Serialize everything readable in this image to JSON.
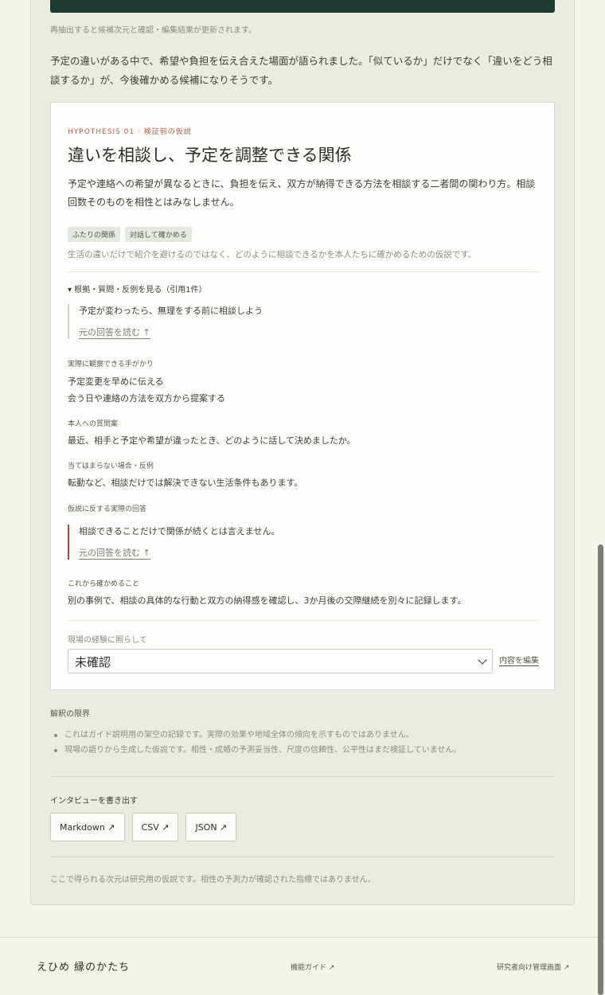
{
  "rerun_note": "再抽出すると候補次元と確認・編集結果が更新されます。",
  "summary": "予定の違いがある中で、希望や負担を伝え合えた場面が語られました。「似ているか」だけでなく「違いをどう相談するか」が、今後確かめる候補になりそうです。",
  "hypothesis": {
    "eyebrow": "HYPOTHESIS 01 · 検証前の仮説",
    "title": "違いを相談し、予定を調整できる関係",
    "description": "予定や連絡への希望が異なるときに、負担を伝え、双方が納得できる方法を相談する二者間の関わり方。相談回数そのものを相性とはみなしません。",
    "tags": [
      "ふたりの関係",
      "対話して確かめる"
    ],
    "purpose": "生活の違いだけで紹介を避けるのではなく、どのように相談できるかを本人たちに確かめるための仮説です。",
    "details_toggle": "▾ 根拠・質問・反例を見る（引用1件）",
    "evidence_quote": "予定が変わったら、無理をする前に相談しよう",
    "read_original": "元の回答を読む ↑",
    "observable_label": "実際に観察できる手がかり",
    "observable_items": [
      "予定変更を早めに伝える",
      "会う日や連絡の方法を双方から提案する"
    ],
    "question_label": "本人への質問案",
    "question_text": "最近、相手と予定や希望が違ったとき、どのように話して決めましたか。",
    "counter_label": "当てはまらない場合・反例",
    "counter_text": "転勤など、相談だけでは解決できない生活条件もあります。",
    "contrary_label": "仮説に反する実際の回答",
    "contrary_quote": "相談できることだけで関係が続くとは言えません。",
    "next_label": "これから確かめること",
    "next_text": "別の事例で、相談の具体的な行動と双方の納得感を確認し、3か月後の交際継続を別々に記録します。",
    "assess_label": "現場の経験に照らして",
    "assess_value": "未確認",
    "edit_label": "内容を編集"
  },
  "limits": {
    "title": "解釈の限界",
    "items": [
      "これはガイド説明用の架空の記録です。実際の効果や地域全体の傾向を示すものではありません。",
      "現場の語りから生成した仮説です。相性・成婚の予測妥当性、尺度の信頼性、公平性はまだ検証していません。"
    ]
  },
  "export": {
    "title": "インタビューを書き出す",
    "buttons": [
      "Markdown ↗",
      "CSV ↗",
      "JSON ↗"
    ]
  },
  "disclaimer": "ここで得られる次元は研究用の仮説です。相性の予測力が確認された指標ではありません。",
  "footer": {
    "brand": "えひめ 縁のかたち",
    "guide_link": "機能ガイド ↗",
    "admin_link": "研究者向け管理画面 ↗"
  }
}
